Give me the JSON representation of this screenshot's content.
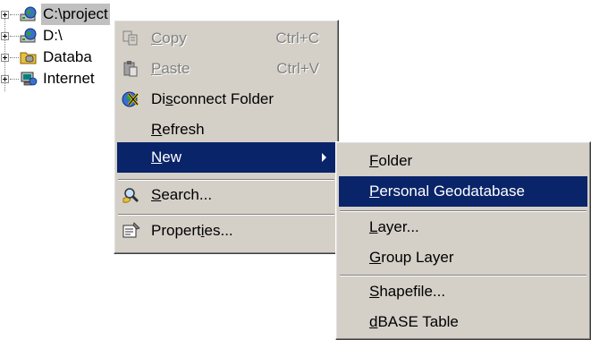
{
  "tree": {
    "items": [
      {
        "label": "C:\\project",
        "icon": "drive-globe-icon",
        "selected": true
      },
      {
        "label": "D:\\",
        "icon": "drive-globe-icon"
      },
      {
        "label": "Databa",
        "icon": "database-connections-icon"
      },
      {
        "label": "Internet",
        "icon": "internet-server-icon"
      }
    ]
  },
  "context_menu": {
    "items": [
      {
        "label_pre": "",
        "label_key": "C",
        "label_post": "opy",
        "shortcut": "Ctrl+C",
        "icon": "copy-icon",
        "disabled": true
      },
      {
        "label_pre": "",
        "label_key": "P",
        "label_post": "aste",
        "shortcut": "Ctrl+V",
        "icon": "paste-icon",
        "disabled": true
      },
      {
        "label_pre": "Di",
        "label_key": "s",
        "label_post": "connect Folder",
        "icon": "disconnect-folder-icon"
      },
      {
        "label_pre": "",
        "label_key": "R",
        "label_post": "efresh"
      },
      {
        "label_pre": "",
        "label_key": "N",
        "label_post": "ew",
        "highlighted": true,
        "submenu": true
      },
      {
        "label_pre": "",
        "label_key": "S",
        "label_post": "earch...",
        "icon": "search-icon"
      },
      {
        "label_pre": "Propert",
        "label_key": "i",
        "label_post": "es...",
        "icon": "properties-icon"
      }
    ]
  },
  "new_submenu": {
    "items": [
      {
        "label_pre": "",
        "label_key": "F",
        "label_post": "older"
      },
      {
        "label_pre": "",
        "label_key": "P",
        "label_post": "ersonal Geodatabase",
        "highlighted": true
      },
      {
        "label_pre": "",
        "label_key": "L",
        "label_post": "ayer..."
      },
      {
        "label_pre": "",
        "label_key": "G",
        "label_post": "roup Layer"
      },
      {
        "label_pre": "",
        "label_key": "S",
        "label_post": "hapefile..."
      },
      {
        "label_pre": "",
        "label_key": "d",
        "label_post": "BASE Table"
      }
    ]
  },
  "colors": {
    "menu_bg": "#d4d0c8",
    "highlight": "#0a246a",
    "selection": "#c0c0c0"
  }
}
